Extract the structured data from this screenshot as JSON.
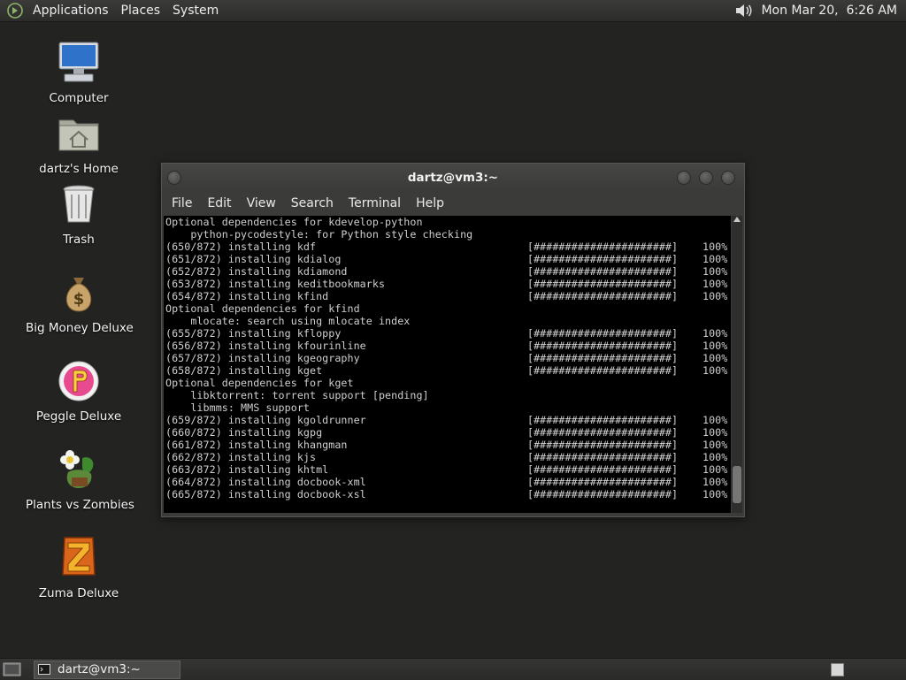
{
  "top_panel": {
    "menus": [
      "Applications",
      "Places",
      "System"
    ],
    "clock": "Mon Mar 20,  6:26 AM"
  },
  "desktop_icons": [
    {
      "label": "Computer"
    },
    {
      "label": "dartz's Home"
    },
    {
      "label": "Trash"
    },
    {
      "label": "Big Money Deluxe"
    },
    {
      "label": "Peggle Deluxe"
    },
    {
      "label": "Plants vs Zombies"
    },
    {
      "label": "Zuma Deluxe"
    }
  ],
  "terminal": {
    "title": "dartz@vm3:~",
    "menu": [
      "File",
      "Edit",
      "View",
      "Search",
      "Terminal",
      "Help"
    ],
    "lines": [
      {
        "text": "Optional dependencies for kdevelop-python"
      },
      {
        "text": "    python-pycodestyle: for Python style checking"
      },
      {
        "text": "(650/872) installing kdf",
        "bar": "[######################]",
        "pct": "100%"
      },
      {
        "text": "(651/872) installing kdialog",
        "bar": "[######################]",
        "pct": "100%"
      },
      {
        "text": "(652/872) installing kdiamond",
        "bar": "[######################]",
        "pct": "100%"
      },
      {
        "text": "(653/872) installing keditbookmarks",
        "bar": "[######################]",
        "pct": "100%"
      },
      {
        "text": "(654/872) installing kfind",
        "bar": "[######################]",
        "pct": "100%"
      },
      {
        "text": "Optional dependencies for kfind"
      },
      {
        "text": "    mlocate: search using mlocate index"
      },
      {
        "text": "(655/872) installing kfloppy",
        "bar": "[######################]",
        "pct": "100%"
      },
      {
        "text": "(656/872) installing kfourinline",
        "bar": "[######################]",
        "pct": "100%"
      },
      {
        "text": "(657/872) installing kgeography",
        "bar": "[######################]",
        "pct": "100%"
      },
      {
        "text": "(658/872) installing kget",
        "bar": "[######################]",
        "pct": "100%"
      },
      {
        "text": "Optional dependencies for kget"
      },
      {
        "text": "    libktorrent: torrent support [pending]"
      },
      {
        "text": "    libmms: MMS support"
      },
      {
        "text": "(659/872) installing kgoldrunner",
        "bar": "[######################]",
        "pct": "100%"
      },
      {
        "text": "(660/872) installing kgpg",
        "bar": "[######################]",
        "pct": "100%"
      },
      {
        "text": "(661/872) installing khangman",
        "bar": "[######################]",
        "pct": "100%"
      },
      {
        "text": "(662/872) installing kjs",
        "bar": "[######################]",
        "pct": "100%"
      },
      {
        "text": "(663/872) installing khtml",
        "bar": "[######################]",
        "pct": "100%"
      },
      {
        "text": "(664/872) installing docbook-xml",
        "bar": "[######################]",
        "pct": "100%"
      },
      {
        "text": "(665/872) installing docbook-xsl",
        "bar": "[######################]",
        "pct": "100%"
      }
    ]
  },
  "taskbar": {
    "task_label": "dartz@vm3:~"
  },
  "colors": {
    "desktop": "#232422",
    "terminal_bg": "#000000",
    "terminal_fg": "#cfcfcf"
  }
}
